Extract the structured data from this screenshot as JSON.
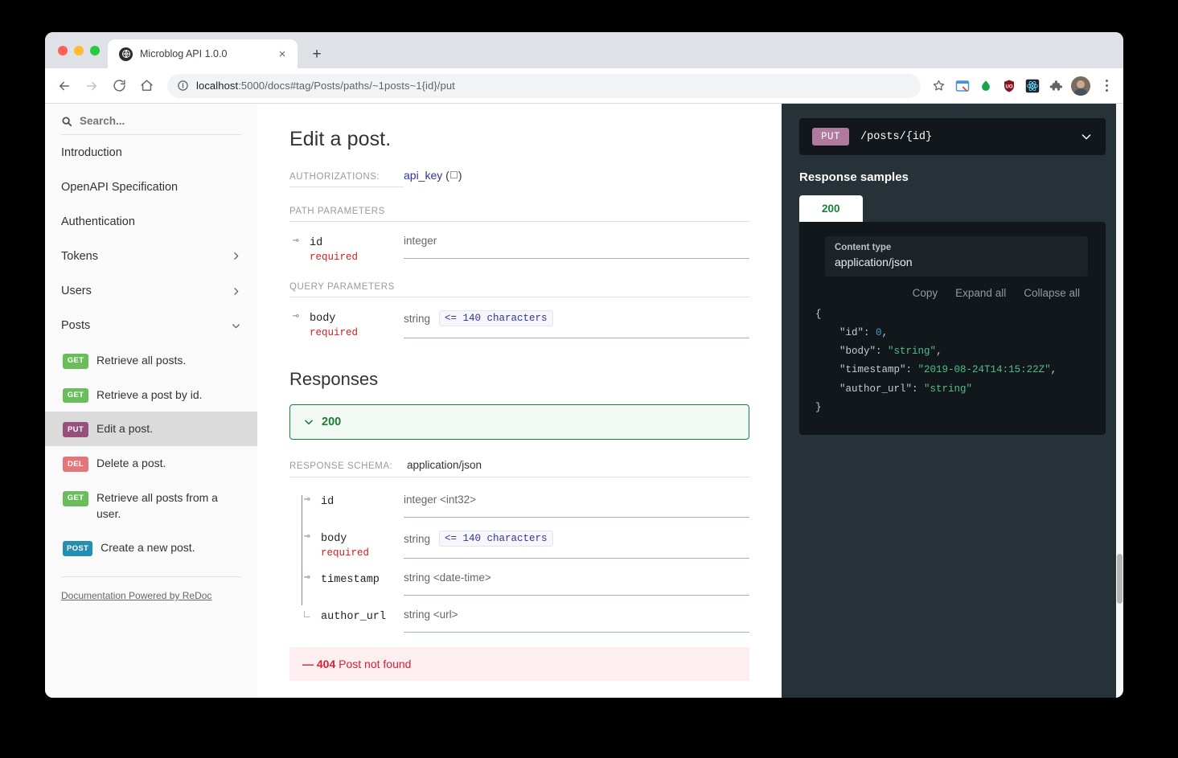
{
  "browser": {
    "tab": {
      "title": "Microblog API 1.0.0",
      "favicon": "globe-icon",
      "close": "×"
    },
    "newtab_label": "+",
    "url_bold": "localhost",
    "url_rest": ":5000/docs#tag/Posts/paths/~1posts~1{id}/put",
    "nav": {
      "back": "←",
      "forward": "→",
      "reload": "↻",
      "home": "⌂"
    },
    "extensions": [
      "window-extension-icon",
      "green-drop-icon",
      "ublock-origin-icon",
      "react-devtools-icon",
      "puzzle-extensions-icon"
    ],
    "avatar": "user-avatar",
    "menu": "three-dot-menu-icon"
  },
  "sidebar": {
    "search_placeholder": "Search...",
    "nav": [
      {
        "label": "Introduction",
        "chevron": ""
      },
      {
        "label": "OpenAPI Specification",
        "chevron": ""
      },
      {
        "label": "Authentication",
        "chevron": ""
      },
      {
        "label": "Tokens",
        "chevron": "chevron-right-icon"
      },
      {
        "label": "Users",
        "chevron": "chevron-right-icon"
      },
      {
        "label": "Posts",
        "chevron": "chevron-down-icon"
      }
    ],
    "operations": [
      {
        "method": "GET",
        "label": "Retrieve all posts.",
        "color": "#6bbd5b",
        "active": false
      },
      {
        "method": "GET",
        "label": "Retrieve a post by id.",
        "color": "#6bbd5b",
        "active": false
      },
      {
        "method": "PUT",
        "label": "Edit a post.",
        "color": "#95507c",
        "active": true
      },
      {
        "method": "DEL",
        "label": "Delete a post.",
        "color": "#e2777a",
        "active": false
      },
      {
        "method": "GET",
        "label": "Retrieve all posts from a user.",
        "color": "#6bbd5b",
        "active": false
      },
      {
        "method": "POST",
        "label": "Create a new post.",
        "color": "#248fb2",
        "active": false
      }
    ],
    "powered_by": "Documentation Powered by ReDoc"
  },
  "main": {
    "title": "Edit a post.",
    "authorizations_label": "AUTHORIZATIONS:",
    "authorizations_value": "api_key",
    "path_params_label": "PATH PARAMETERS",
    "path_params": [
      {
        "name": "id",
        "required": "required",
        "type": "integer",
        "chip": ""
      }
    ],
    "query_params_label": "QUERY PARAMETERS",
    "query_params": [
      {
        "name": "body",
        "required": "required",
        "type": "string",
        "chip": "<= 140 characters"
      }
    ],
    "responses_title": "Responses",
    "response_200": "200",
    "response_schema_label": "RESPONSE SCHEMA:",
    "response_schema_value": "application/json",
    "schema_fields": [
      {
        "name": "id",
        "required": "",
        "type": "integer <int32>",
        "chip": ""
      },
      {
        "name": "body",
        "required": "required",
        "type": "string",
        "chip": "<= 140 characters"
      },
      {
        "name": "timestamp",
        "required": "",
        "type": "string <date-time>",
        "chip": ""
      },
      {
        "name": "author_url",
        "required": "",
        "type": "string <url>",
        "chip": ""
      }
    ],
    "error": {
      "dash": "—",
      "code": "404",
      "message": "Post not found"
    }
  },
  "rightpanel": {
    "method": "PUT",
    "path": "/posts/{id}",
    "method_color": "#b07a9e",
    "response_samples_title": "Response samples",
    "status_tab": "200",
    "content_type_label": "Content type",
    "content_type_value": "application/json",
    "actions": {
      "copy": "Copy",
      "expand": "Expand all",
      "collapse": "Collapse all"
    },
    "json_sample": {
      "open": "{",
      "lines": [
        {
          "key": "\"id\"",
          "sep": ": ",
          "value": "0",
          "vtype": "num",
          "comma": ","
        },
        {
          "key": "\"body\"",
          "sep": ": ",
          "value": "\"string\"",
          "vtype": "str",
          "comma": ","
        },
        {
          "key": "\"timestamp\"",
          "sep": ": ",
          "value": "\"2019-08-24T14:15:22Z\"",
          "vtype": "str",
          "comma": ","
        },
        {
          "key": "\"author_url\"",
          "sep": ": ",
          "value": "\"string\"",
          "vtype": "str",
          "comma": ""
        }
      ],
      "close": "}"
    }
  }
}
